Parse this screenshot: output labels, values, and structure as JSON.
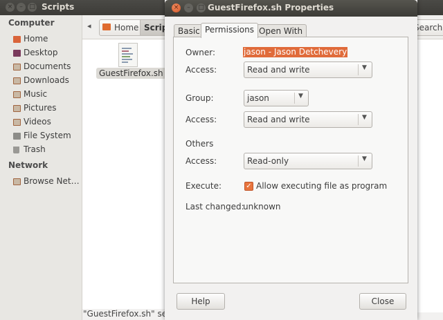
{
  "file_manager": {
    "title": "Scripts",
    "window_controls": {
      "close": "×",
      "minimize": "–",
      "maximize": "□"
    },
    "sidebar": {
      "sections": [
        {
          "heading": "Computer",
          "items": [
            {
              "label": "Home",
              "icon": "home-folder-icon"
            },
            {
              "label": "Desktop",
              "icon": "desktop-icon"
            },
            {
              "label": "Documents",
              "icon": "documents-folder-icon"
            },
            {
              "label": "Downloads",
              "icon": "downloads-folder-icon"
            },
            {
              "label": "Music",
              "icon": "music-folder-icon"
            },
            {
              "label": "Pictures",
              "icon": "pictures-folder-icon"
            },
            {
              "label": "Videos",
              "icon": "videos-folder-icon"
            },
            {
              "label": "File System",
              "icon": "drive-icon"
            },
            {
              "label": "Trash",
              "icon": "trash-icon"
            }
          ]
        },
        {
          "heading": "Network",
          "items": [
            {
              "label": "Browse Net…",
              "icon": "network-icon"
            }
          ]
        }
      ]
    },
    "toolbar": {
      "back_glyph": "◂",
      "breadcrumb": [
        "Home",
        "Scrip"
      ],
      "search_label": "Search"
    },
    "files": [
      {
        "name": "GuestFirefox.sh",
        "icon": "text-file-icon"
      }
    ],
    "status": "\"GuestFirefox.sh\" sele"
  },
  "dialog": {
    "title": "GuestFirefox.sh Properties",
    "window_controls": {
      "close": "×",
      "minimize": "–",
      "maximize": "□"
    },
    "tabs": [
      "Basic",
      "Permissions",
      "Open With"
    ],
    "active_tab": "Permissions",
    "permissions": {
      "owner_label": "Owner:",
      "owner_value": "jason - Jason Detchevery",
      "owner_access_label": "Access:",
      "owner_access": "Read and write",
      "group_label": "Group:",
      "group_value": "jason",
      "group_access_label": "Access:",
      "group_access": "Read and write",
      "others_heading": "Others",
      "others_access_label": "Access:",
      "others_access": "Read-only",
      "execute_label": "Execute:",
      "execute_checked": true,
      "execute_check_glyph": "✓",
      "execute_text": "Allow executing file as program",
      "last_changed_label": "Last changed:",
      "last_changed_value": "unknown",
      "dropdown_arrow": "▼"
    },
    "buttons": {
      "help": "Help",
      "close": "Close"
    }
  },
  "colors": {
    "accent": "#e06b3a",
    "titlebar": "#3c3b37"
  }
}
